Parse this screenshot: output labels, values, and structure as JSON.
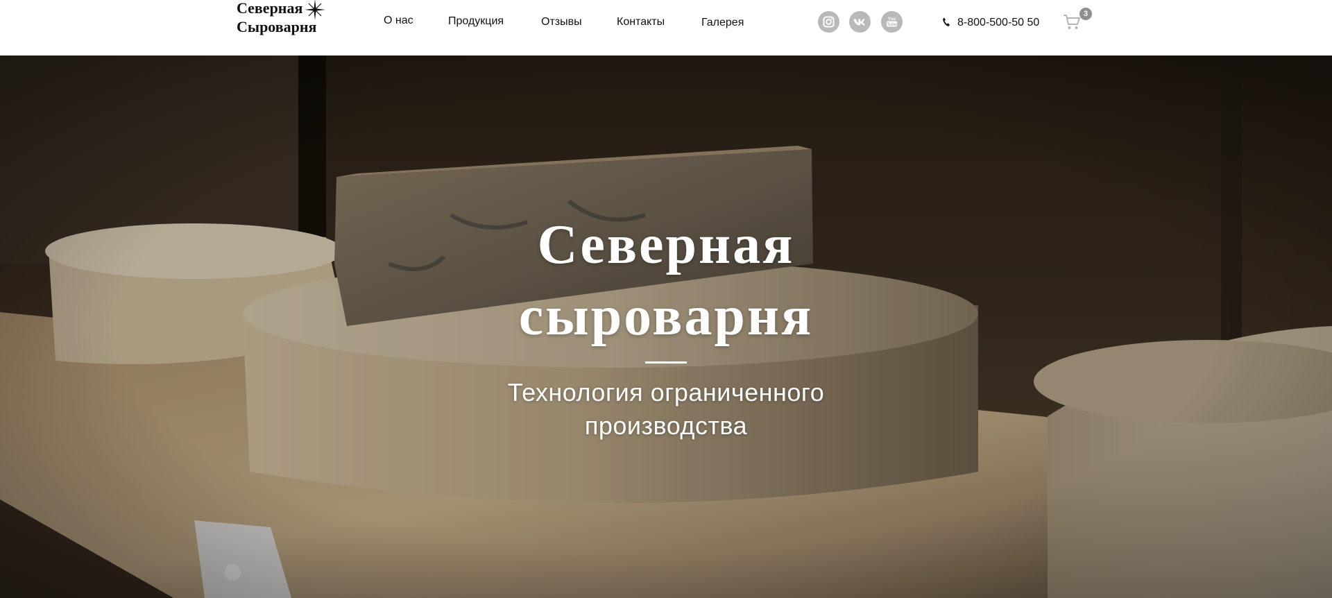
{
  "header": {
    "logo": {
      "line1": "Северная",
      "line2": "Сыроварня"
    },
    "nav": [
      {
        "label": "О нас"
      },
      {
        "label": "Продукция"
      },
      {
        "label": "Отзывы"
      },
      {
        "label": "Контакты"
      },
      {
        "label": "Галерея"
      }
    ],
    "social": [
      {
        "icon": "instagram-icon"
      },
      {
        "icon": "vk-icon"
      },
      {
        "icon": "youtube-icon"
      }
    ],
    "phone": {
      "icon": "phone-icon",
      "number": "8-800-500-50 50"
    },
    "cart": {
      "icon": "cart-icon",
      "count": "3"
    }
  },
  "hero": {
    "title_line1": "Северная",
    "title_line2": "сыроварня",
    "subtitle_line1": "Технология ограниченного",
    "subtitle_line2": "производства"
  },
  "colors": {
    "header_background": "#ffffff",
    "text": "#111111",
    "social_icon_background": "#b9b9b9",
    "cart_badge": "#8f8f8f",
    "hero_text": "#ffffff"
  }
}
